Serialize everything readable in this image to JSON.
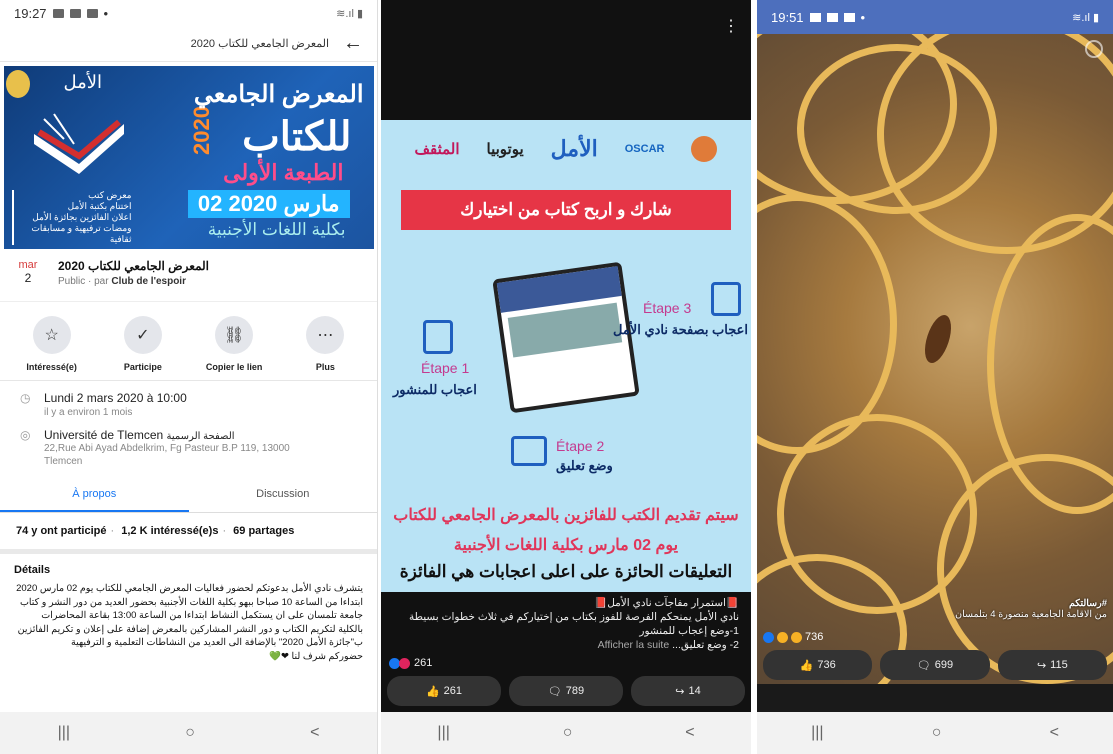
{
  "panel1": {
    "status": {
      "time": "19:27",
      "right": "≋.ıl ▮"
    },
    "topbar": {
      "title": "المعرض الجامعي للكتاب 2020",
      "back": "←"
    },
    "cover": {
      "t1": "المعرض الجامعي",
      "year": "2020",
      "t2": "للكتاب",
      "t3": "الطبعة الأولى",
      "t4": "02 مارس 2020",
      "t5": "بكلية اللغات الأجنبية",
      "logo": "الأمل",
      "side": "معرض كتب\nاختتام بكتبة الأمل\nاعلان الفائزين بجائزة الأمل\nومضات ترفيهية و مسابقات ثقافية"
    },
    "event": {
      "month": "mar",
      "day": "2",
      "title": "المعرض الجامعي للكتاب 2020",
      "sub_prefix": "Public · par",
      "sub_author": "Club de l'espoir"
    },
    "actions": [
      {
        "label": "Intéressé(e)",
        "icon": "☆"
      },
      {
        "label": "Participe",
        "icon": "✓"
      },
      {
        "label": "Copier le lien",
        "icon": "⛓"
      },
      {
        "label": "Plus",
        "icon": "⋯"
      }
    ],
    "when": {
      "date": "Lundi 2 mars 2020 à 10:00",
      "ago": "il y a environ 1 mois"
    },
    "where": {
      "name": "Université de Tlemcen",
      "name_ar": "الصفحة الرسمية",
      "addr1": "22,Rue Abi Ayad Abdelkrim, Fg Pasteur B.P 119, 13000",
      "addr2": "Tlemcen"
    },
    "tabs": [
      {
        "label": "À propos"
      },
      {
        "label": "Discussion"
      }
    ],
    "stats": {
      "a": "74 y ont participé",
      "b": "1,2 K intéressé(e)s",
      "c": "69 partages"
    },
    "details": {
      "title": "Détails",
      "text": "يتشرف نادي الأمل بدعوتكم لحضور فعاليات المعرض الجامعي للكتاب يوم 02 مارس 2020 ابتداءا من الساعة 10 صباحا ببهو بكلية اللغات الأجنبية بحضور العديد من دور النشر و كتاب جامعة تلمسان على ان يستكمل النشاط ابتداءا من الساعة 13:00 بقاعة المحاضرات بالكلية لتكريم الكتاب و دور النشر المشاركين بالمعرض إضافة على إعلان و تكريم الفائزين ب\"جائزة الأمل 2020\" بالإضافة الى العديد من النشاطات التعلمية و الترفيهية",
      "end": "حضوركم شرف لنا ❤💚"
    },
    "nav": {
      "recent": "|||",
      "home": "○",
      "back": "<"
    }
  },
  "panel2": {
    "poster": {
      "logos": [
        "المثقف",
        "يوتوبيا",
        "الأمل",
        "OSCAR",
        ""
      ],
      "banner": "شارك و اربح كتاب من اختيارك",
      "step1": "Étape 1",
      "step1_sub": "اعجاب للمنشور",
      "step2": "Étape 2",
      "step2_sub": "وضع تعليق",
      "step3": "Étape 3",
      "step3_sub": "اعجاب بصفحة نادي الأمل",
      "bottom1": "سيتم تقديم الكتب للفائزين بالمعرض الجامعي للكتاب",
      "bottom2": "يوم 02 مارس بكلية اللغات الأجنبية",
      "bottom3": "التعليقات الحائزة على اعلى اعجابات هي الفائزة"
    },
    "post": {
      "line1": "📕استمرار مفاجآت نادي الأمل📕",
      "line2": "نادي الأمل يمنحكم الفرصة للفوز بكتاب من إختياركم في ثلاث خطوات بسيطة",
      "line3": "1-وضع إعجاب للمنشور",
      "line4_a": "2- وضع تعليق...",
      "more": "Afficher la suite"
    },
    "reacts": "261",
    "buttons": [
      "261",
      "789",
      "14"
    ],
    "nav": {
      "recent": "|||",
      "home": "○",
      "back": "<"
    }
  },
  "panel3": {
    "status": {
      "time": "19:51",
      "right": "≋.ıl ▮"
    },
    "caption1": "#رسالتكم",
    "caption2": "من الاقامة الجامعية منصورة 4 بتلمسان",
    "reacts": "736",
    "buttons": [
      "736",
      "699",
      "115"
    ],
    "nav": {
      "recent": "|||",
      "home": "○",
      "back": "<"
    }
  }
}
